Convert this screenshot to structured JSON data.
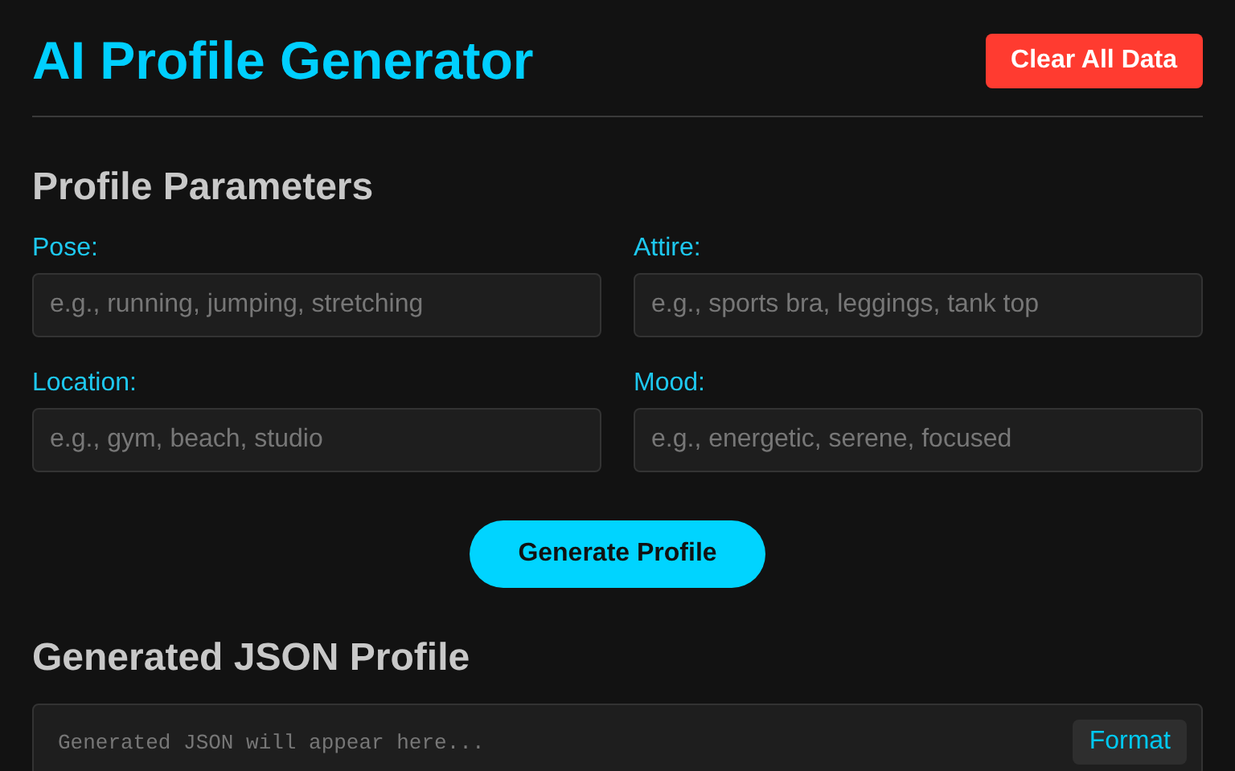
{
  "header": {
    "title": "AI Profile Generator",
    "clear_button": "Clear All Data"
  },
  "parameters": {
    "heading": "Profile Parameters",
    "fields": [
      {
        "label": "Pose:",
        "placeholder": "e.g., running, jumping, stretching"
      },
      {
        "label": "Attire:",
        "placeholder": "e.g., sports bra, leggings, tank top"
      },
      {
        "label": "Location:",
        "placeholder": "e.g., gym, beach, studio"
      },
      {
        "label": "Mood:",
        "placeholder": "e.g., energetic, serene, focused"
      }
    ],
    "generate_button": "Generate Profile"
  },
  "output": {
    "heading": "Generated JSON Profile",
    "placeholder": "Generated JSON will appear here...",
    "format_button": "Format"
  }
}
